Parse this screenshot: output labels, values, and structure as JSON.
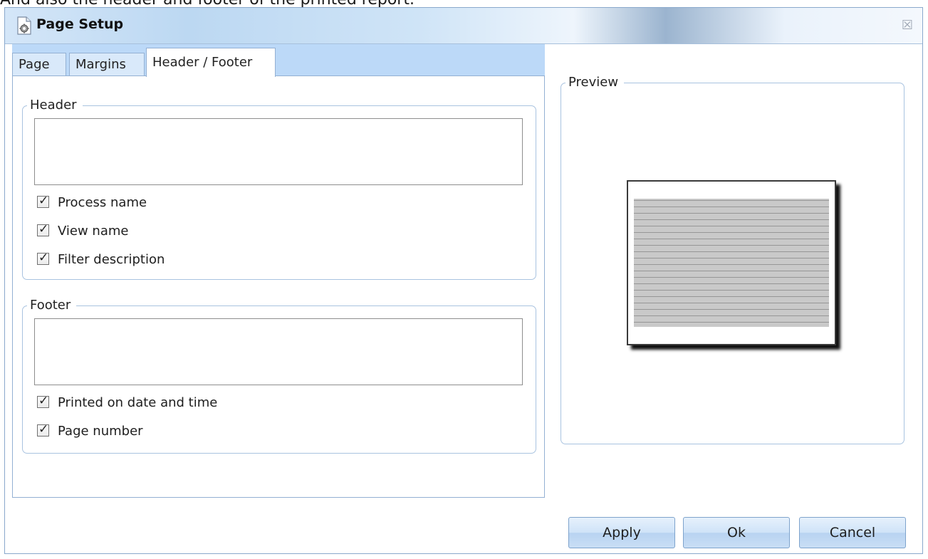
{
  "caption": "And also the header and footer of the printed report.",
  "window": {
    "title": "Page Setup",
    "icon": "page-setup-icon",
    "close_icon": "close-icon",
    "close_glyph": "☒"
  },
  "tabs": [
    {
      "label": "Page",
      "active": false
    },
    {
      "label": "Margins",
      "active": false
    },
    {
      "label": "Header / Footer",
      "active": true
    }
  ],
  "header_group": {
    "legend": "Header",
    "text_value": "",
    "options": [
      {
        "label": "Process name",
        "checked": true
      },
      {
        "label": "View name",
        "checked": true
      },
      {
        "label": "Filter description",
        "checked": true
      }
    ]
  },
  "footer_group": {
    "legend": "Footer",
    "text_value": "",
    "options": [
      {
        "label": "Printed on date and time",
        "checked": true
      },
      {
        "label": "Page number",
        "checked": true
      }
    ]
  },
  "preview": {
    "legend": "Preview"
  },
  "buttons": {
    "apply": "Apply",
    "ok": "Ok",
    "cancel": "Cancel"
  },
  "check_glyph": "✓"
}
